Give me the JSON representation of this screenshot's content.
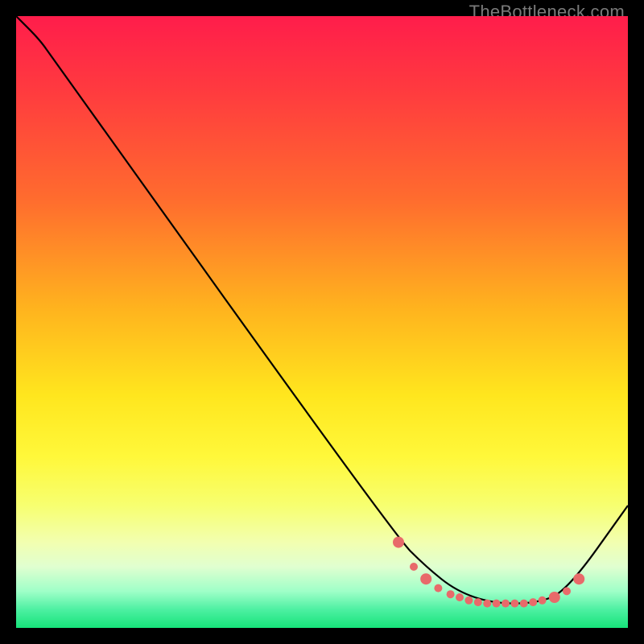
{
  "watermark": "TheBottleneck.com",
  "chart_data": {
    "type": "line",
    "title": "",
    "xlabel": "",
    "ylabel": "",
    "xlim": [
      0,
      100
    ],
    "ylim": [
      0,
      100
    ],
    "grid": false,
    "gradient_stops": [
      {
        "offset": 0,
        "color": "#ff1d4b"
      },
      {
        "offset": 12,
        "color": "#ff3a3f"
      },
      {
        "offset": 30,
        "color": "#ff6c2e"
      },
      {
        "offset": 48,
        "color": "#ffb41e"
      },
      {
        "offset": 62,
        "color": "#ffe61e"
      },
      {
        "offset": 72,
        "color": "#fff83a"
      },
      {
        "offset": 80,
        "color": "#f7ff70"
      },
      {
        "offset": 86,
        "color": "#f2ffb0"
      },
      {
        "offset": 90,
        "color": "#e0ffd0"
      },
      {
        "offset": 94,
        "color": "#9fffc8"
      },
      {
        "offset": 97,
        "color": "#4df0a2"
      },
      {
        "offset": 100,
        "color": "#16e37a"
      }
    ],
    "series": [
      {
        "name": "bottleneck-curve",
        "x": [
          0,
          4,
          6,
          62,
          67,
          72,
          78,
          85,
          90,
          100
        ],
        "y": [
          100,
          96,
          93,
          15,
          10,
          6,
          4,
          4,
          6,
          20
        ]
      }
    ],
    "markers": {
      "name": "highlight-dots",
      "color": "#e86a6a",
      "radius_large": 7,
      "radius_small": 5,
      "points": [
        {
          "x": 62.5,
          "y": 14,
          "r": "large"
        },
        {
          "x": 65,
          "y": 10,
          "r": "small"
        },
        {
          "x": 67,
          "y": 8,
          "r": "large"
        },
        {
          "x": 69,
          "y": 6.5,
          "r": "small"
        },
        {
          "x": 71,
          "y": 5.5,
          "r": "small"
        },
        {
          "x": 72.5,
          "y": 5,
          "r": "small"
        },
        {
          "x": 74,
          "y": 4.5,
          "r": "small"
        },
        {
          "x": 75.5,
          "y": 4.2,
          "r": "small"
        },
        {
          "x": 77,
          "y": 4,
          "r": "small"
        },
        {
          "x": 78.5,
          "y": 4,
          "r": "small"
        },
        {
          "x": 80,
          "y": 4,
          "r": "small"
        },
        {
          "x": 81.5,
          "y": 4,
          "r": "small"
        },
        {
          "x": 83,
          "y": 4,
          "r": "small"
        },
        {
          "x": 84.5,
          "y": 4.2,
          "r": "small"
        },
        {
          "x": 86,
          "y": 4.5,
          "r": "small"
        },
        {
          "x": 88,
          "y": 5,
          "r": "large"
        },
        {
          "x": 90,
          "y": 6,
          "r": "small"
        },
        {
          "x": 92,
          "y": 8,
          "r": "large"
        }
      ]
    }
  }
}
